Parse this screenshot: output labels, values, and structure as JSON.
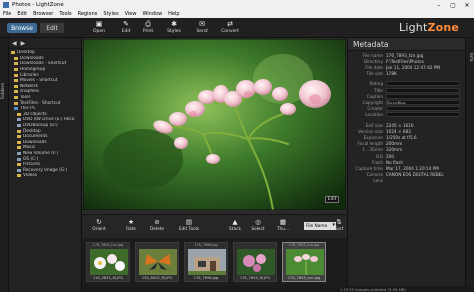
{
  "window": {
    "title": "Photos - LightZone"
  },
  "menubar": [
    "File",
    "Edit",
    "Browser",
    "Tools",
    "Regions",
    "Styles",
    "View",
    "Window",
    "Help"
  ],
  "mode_tabs": {
    "browse": "Browse",
    "edit": "Edit"
  },
  "toolbar": [
    {
      "label": "Open",
      "icon": "open-icon"
    },
    {
      "label": "Edit",
      "icon": "edit-icon"
    },
    {
      "label": "Print",
      "icon": "print-icon"
    },
    {
      "label": "Styles",
      "icon": "styles-icon"
    },
    {
      "label": "Send",
      "icon": "send-icon"
    },
    {
      "label": "Convert",
      "icon": "convert-icon"
    }
  ],
  "logo": {
    "light": "Light",
    "zone": "Zone"
  },
  "side_tabs": {
    "left": "Folders",
    "right": "Info"
  },
  "folder_tree": [
    {
      "label": "Desktop",
      "type": "folder",
      "indent": 0
    },
    {
      "label": "Downloads",
      "type": "folder",
      "indent": 1
    },
    {
      "label": "Downloads - Shortcut",
      "type": "folder",
      "indent": 1
    },
    {
      "label": "Homegroup",
      "type": "folder",
      "indent": 1
    },
    {
      "label": "Libraries",
      "type": "folder",
      "indent": 1
    },
    {
      "label": "Movies - Shortcut",
      "type": "folder",
      "indent": 1
    },
    {
      "label": "Network",
      "type": "folder",
      "indent": 1
    },
    {
      "label": "snapfiles",
      "type": "folder",
      "indent": 1
    },
    {
      "label": "Tools",
      "type": "folder",
      "indent": 1
    },
    {
      "label": "TestFiles - Shortcut",
      "type": "folder",
      "indent": 1
    },
    {
      "label": "This PC",
      "type": "pc",
      "indent": 1
    },
    {
      "label": "3D Objects",
      "type": "folder",
      "indent": 2
    },
    {
      "label": "DVD RW Drive (E:) Reco",
      "type": "drive",
      "indent": 2
    },
    {
      "label": "DVDBackup (D:)",
      "type": "drive",
      "indent": 2
    },
    {
      "label": "Desktop",
      "type": "folder",
      "indent": 2
    },
    {
      "label": "Documents",
      "type": "folder",
      "indent": 2
    },
    {
      "label": "Downloads",
      "type": "folder",
      "indent": 2
    },
    {
      "label": "Music",
      "type": "folder",
      "indent": 2
    },
    {
      "label": "New Volume (F:)",
      "type": "drive",
      "indent": 2
    },
    {
      "label": "OS (C:)",
      "type": "drive",
      "indent": 2
    },
    {
      "label": "Pictures",
      "type": "folder",
      "indent": 2
    },
    {
      "label": "Recovery Image (G:)",
      "type": "drive",
      "indent": 2
    },
    {
      "label": "Videos",
      "type": "folder",
      "indent": 2
    }
  ],
  "viewer": {
    "edit_badge": "Edit"
  },
  "bottom_toolbar": [
    {
      "label": "Orient",
      "icon": "orient-icon"
    },
    {
      "label": "Rate",
      "icon": "star-icon"
    },
    {
      "label": "Delete",
      "icon": "delete-icon"
    },
    {
      "label": "Edit Tools",
      "icon": "edit-tools-icon"
    },
    {
      "label": "Stack",
      "icon": "stack-icon"
    },
    {
      "label": "Select",
      "icon": "select-icon"
    },
    {
      "label": "Thu...",
      "icon": "thumbnail-size-icon"
    },
    {
      "label": "Sort",
      "icon": "sort-icon"
    }
  ],
  "sort_select": {
    "value": "File Name"
  },
  "thumbnails": [
    {
      "top": "176_7893_tun.jpg",
      "name": "116_5833_RJ.JPG",
      "kind": "flowers"
    },
    {
      "top": "",
      "name": "133_6625_RJ.JPG",
      "kind": "butterfly"
    },
    {
      "top": "176_7896.jpg",
      "name": "176_7896.jpg",
      "kind": "house"
    },
    {
      "top": "",
      "name": "176_7893_RJ.JPG",
      "kind": "orchid"
    },
    {
      "top": "176_7893_tun.jpg",
      "name": "176_7893_tun.jpg",
      "kind": "blossom",
      "selected": true
    }
  ],
  "status": {
    "text": "1 Of 25 Images selected (3.09 MB)"
  },
  "metadata": {
    "title": "Metadata",
    "rows": [
      {
        "k": "File name",
        "v": "176_7893_tzn.jpg"
      },
      {
        "k": "Directory",
        "v": "F:\\TestFiles\\Photos"
      },
      {
        "k": "File date",
        "v": "Jan 11, 2004 12:47:42 PM"
      },
      {
        "k": "File size",
        "v": "178K"
      },
      {
        "k": "",
        "v": ""
      },
      {
        "k": "Rating",
        "v": "",
        "box": true
      },
      {
        "k": "Title",
        "v": "",
        "box": true
      },
      {
        "k": "Caption",
        "v": "",
        "box": true
      },
      {
        "k": "Copyright",
        "v": "Snapfiles",
        "box": true
      },
      {
        "k": "Creator",
        "v": "",
        "box": true
      },
      {
        "k": "Location",
        "v": "",
        "box": true
      },
      {
        "k": "",
        "v": ""
      },
      {
        "k": "Exif size",
        "v": "2245 × 1610"
      },
      {
        "k": "Version size",
        "v": "1024 × 683"
      },
      {
        "k": "Exposure",
        "v": "1/250s at f/5.6"
      },
      {
        "k": "Focal length",
        "v": "200mm"
      },
      {
        "k": "F. ..35mm",
        "v": "320mm"
      },
      {
        "k": "ISO",
        "v": "200"
      },
      {
        "k": "Flash",
        "v": "No flash"
      },
      {
        "k": "Capture time",
        "v": "Mar 17, 2004 1:20:14 PM"
      },
      {
        "k": "Camera",
        "v": "CANON EOS DIGITAL REBEL"
      },
      {
        "k": "Lens",
        "v": "",
        "pipe": true
      }
    ]
  },
  "colors": {
    "accent": "#3d6a92",
    "logo_orange": "#ff8c3a"
  }
}
